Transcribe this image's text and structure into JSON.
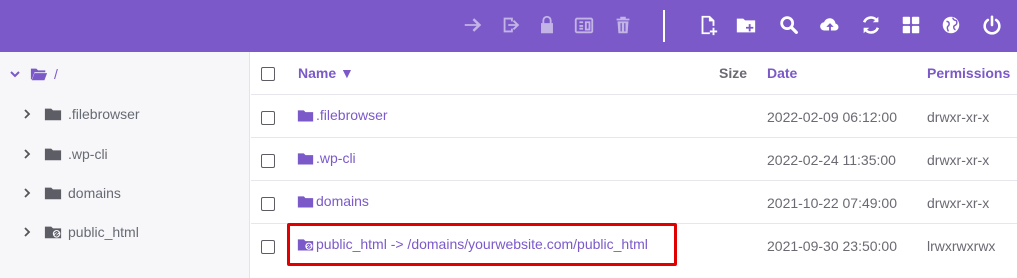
{
  "toolbar": {
    "left_actions": [
      {
        "icon": "arrow-right-icon",
        "label": "move",
        "enabled": false
      },
      {
        "icon": "exit-icon",
        "label": "rename",
        "enabled": false
      },
      {
        "icon": "lock-icon",
        "label": "permissions",
        "enabled": false
      },
      {
        "icon": "archive-icon",
        "label": "compress",
        "enabled": false
      },
      {
        "icon": "trash-icon",
        "label": "delete",
        "enabled": false
      }
    ],
    "right_actions": [
      {
        "icon": "new-file-icon"
      },
      {
        "icon": "new-folder-icon"
      },
      {
        "icon": "search-icon"
      },
      {
        "icon": "upload-icon"
      },
      {
        "icon": "refresh-icon"
      },
      {
        "icon": "grid-view-icon"
      },
      {
        "icon": "globe-icon"
      },
      {
        "icon": "power-icon"
      }
    ],
    "background_color": "#7b59c9"
  },
  "sidebar": {
    "root_label": "/",
    "items": [
      {
        "label": ".filebrowser",
        "icon": "folder-icon"
      },
      {
        "label": ".wp-cli",
        "icon": "folder-icon"
      },
      {
        "label": "domains",
        "icon": "folder-icon"
      },
      {
        "label": "public_html",
        "icon": "folder-link-icon"
      }
    ]
  },
  "table": {
    "columns": {
      "name": "Name ▼",
      "size": "Size",
      "date": "Date",
      "permissions": "Permissions"
    },
    "rows": [
      {
        "name": ".filebrowser",
        "icon": "folder-icon",
        "size": "",
        "date": "2022-02-09 06:12:00",
        "permissions": "drwxr-xr-x"
      },
      {
        "name": ".wp-cli",
        "icon": "folder-icon",
        "size": "",
        "date": "2022-02-24 11:35:00",
        "permissions": "drwxr-xr-x"
      },
      {
        "name": "domains",
        "icon": "folder-icon",
        "size": "",
        "date": "2021-10-22 07:49:00",
        "permissions": "drwxr-xr-x"
      },
      {
        "name": "public_html -> /domains/yourwebsite.com/public_html",
        "icon": "folder-link-icon",
        "size": "",
        "date": "2021-09-30 23:50:00",
        "permissions": "lrwxrwxrwx"
      }
    ]
  },
  "colors": {
    "accent": "#7b59c9",
    "highlight_border": "#e00000"
  }
}
